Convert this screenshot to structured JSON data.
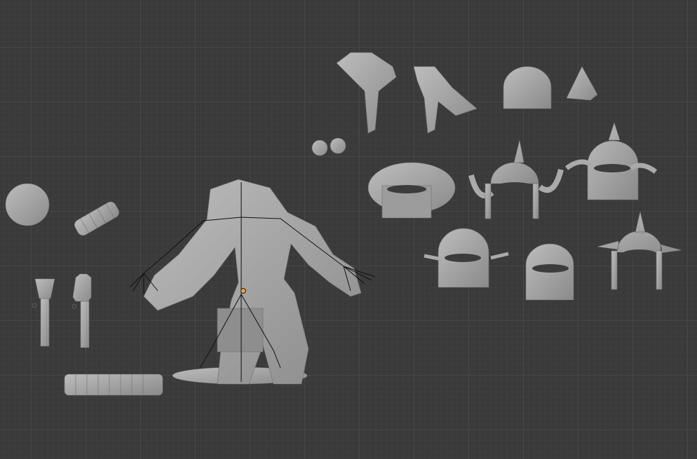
{
  "viewport": {
    "background_color": "#3a3a3a",
    "grid_color": "#474747",
    "mesh_color": "#a8a8a8",
    "mesh_shadow_color": "#7c7c7c",
    "bone_color": "#111111",
    "origin_color": "#f0a030"
  }
}
